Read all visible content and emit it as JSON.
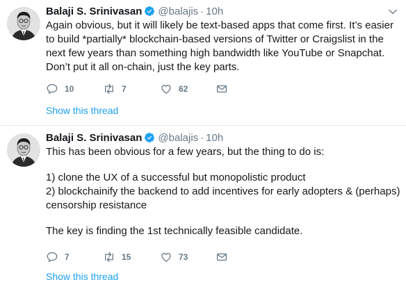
{
  "tweets": [
    {
      "author_name": "Balaji S. Srinivasan",
      "handle": "@balajis",
      "separator": "·",
      "time": "10h",
      "text": "Again obvious, but it will likely be text-based apps that come first. It’s easier to build *partially* blockchain-based versions of Twitter or Craigslist in the next few years than something high bandwidth like YouTube or Snapchat. Don’t put it all on-chain, just the key parts.",
      "reply_count": "10",
      "retweet_count": "7",
      "like_count": "62",
      "show_thread": "Show this thread"
    },
    {
      "author_name": "Balaji S. Srinivasan",
      "handle": "@balajis",
      "separator": "·",
      "time": "10h",
      "lines": [
        "This has been obvious for a few years, but the thing to do is:",
        "1) clone the UX of a successful but monopolistic product",
        "2) blockchainify the backend to add incentives for early adopters & (perhaps) censorship resistance",
        "The key is finding the 1st technically feasible candidate."
      ],
      "reply_count": "7",
      "retweet_count": "15",
      "like_count": "73",
      "show_thread": "Show this thread"
    }
  ],
  "icons": {
    "verified": "verified-badge-icon",
    "reply": "reply-icon",
    "retweet": "retweet-icon",
    "like": "heart-icon",
    "dm": "envelope-icon",
    "more": "chevron-down-icon"
  },
  "colors": {
    "link": "#1da1f2",
    "muted": "#657786",
    "text": "#14171a",
    "divider": "#e6ecf0"
  }
}
